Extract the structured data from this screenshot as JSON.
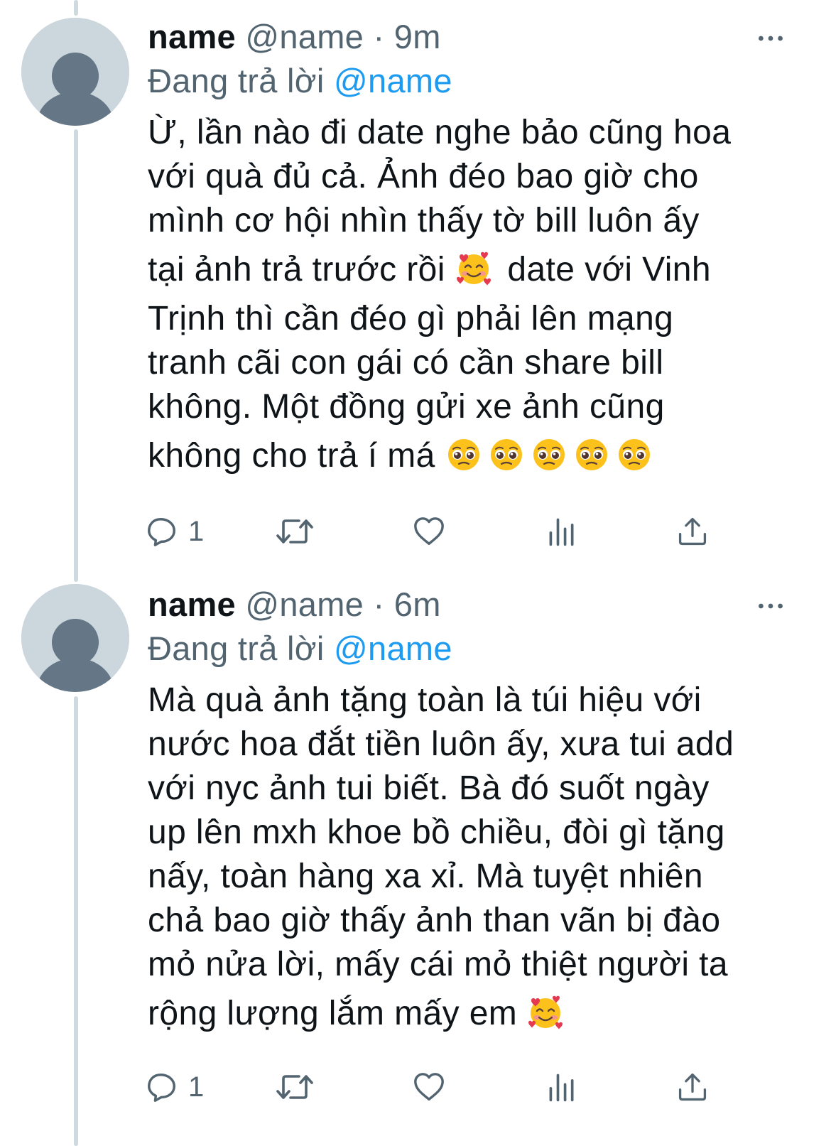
{
  "tweets": [
    {
      "display_name": "name",
      "handle": "@name",
      "separator": "·",
      "time": "9m",
      "reply_prefix": "Đang trả lời",
      "reply_to": "@name",
      "lines": [
        "Ừ, lần nào đi date nghe bảo cũng hoa",
        "với quà đủ cả. Ảnh đéo bao giờ cho",
        "mình cơ hội nhìn thấy tờ bill luôn ấy",
        "tại ảnh trả trước rồi",
        "date với Vinh",
        "Trịnh thì cần đéo gì phải lên mạng",
        "tranh cãi con gái có cần share bill",
        "không. Một đồng gửi xe ảnh cũng",
        "không cho trả í má"
      ],
      "emojis": [
        "smiling-face-with-hearts",
        "pleading-face",
        "pleading-face",
        "pleading-face",
        "pleading-face",
        "pleading-face"
      ],
      "reply_count": "1"
    },
    {
      "display_name": "name",
      "handle": "@name",
      "separator": "·",
      "time": "6m",
      "reply_prefix": "Đang trả lời",
      "reply_to": "@name",
      "lines": [
        "Mà quà ảnh tặng toàn là túi hiệu với",
        "nước hoa đắt tiền luôn ấy, xưa tui add",
        "với nyc ảnh tui biết. Bà đó suốt ngày",
        "up lên mxh khoe bồ chiều, đòi gì tặng",
        "nấy, toàn hàng xa xỉ. Mà tuyệt nhiên",
        "chả bao giờ thấy ảnh than vãn bị đào",
        "mỏ nửa lời, mấy cái mỏ thiệt người ta",
        "rộng lượng lắm mấy em"
      ],
      "emojis": [
        "smiling-face-with-hearts"
      ],
      "reply_count": "1"
    }
  ],
  "icons": {
    "avatar": "default-avatar-icon",
    "more": "more-options-icon",
    "reply": "reply-icon",
    "retweet": "retweet-icon",
    "like": "like-icon",
    "analytics": "analytics-icon",
    "share": "share-icon"
  },
  "colors": {
    "accent": "#1d9bf0",
    "text": "#0f1419",
    "secondary": "#536471",
    "thread_line": "#cfd9de",
    "avatar_bg": "#ccd6dd",
    "avatar_fg": "#657786"
  }
}
